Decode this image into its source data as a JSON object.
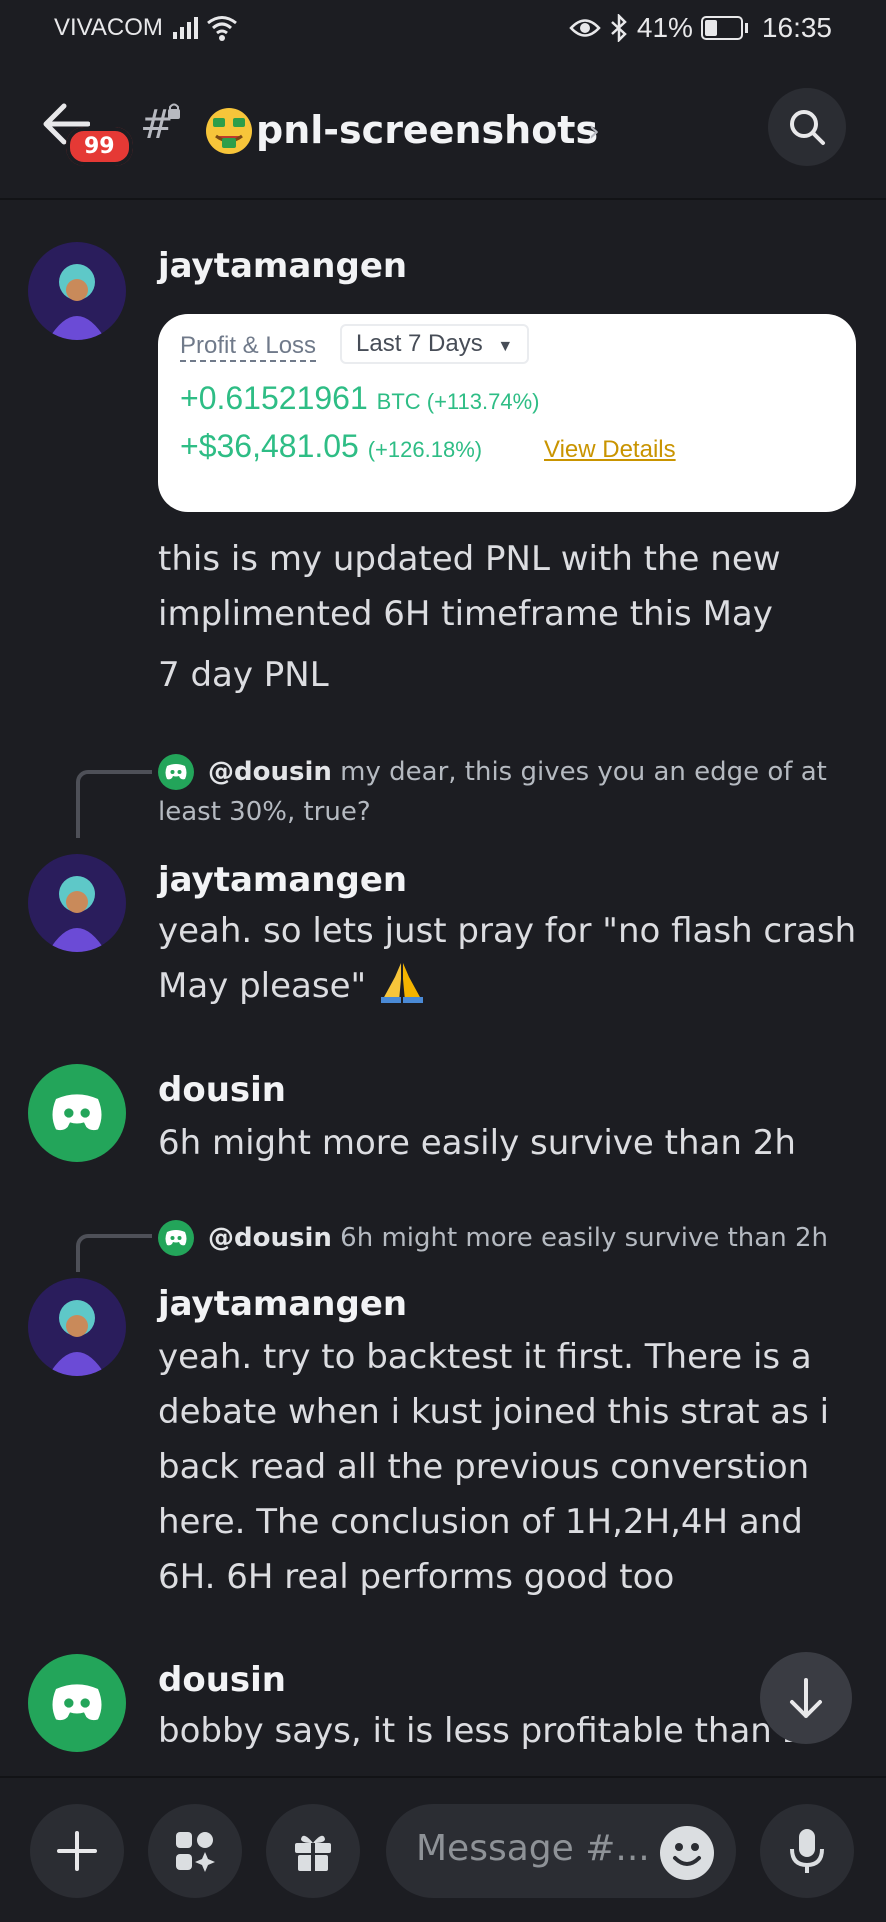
{
  "status_bar": {
    "carrier": "VIVACOM",
    "battery": "41%",
    "battery_level": 0.41,
    "time": "16:35"
  },
  "header": {
    "unread_count": "99",
    "channel_name": "pnl-screenshots",
    "channel_emoji": "money-mouth-face"
  },
  "messages": [
    {
      "username": "jaytamangen",
      "pnl_card": {
        "label": "Profit & Loss",
        "range": "Last 7 Days",
        "btc_value": "+0.61521961",
        "btc_unit": "BTC (+113.74%)",
        "usd_value": "+$36,481.05",
        "usd_pct": "(+126.18%)",
        "details_link": "View Details"
      },
      "lines": [
        "this is my updated PNL with the new",
        "implimented 6H timeframe this May",
        "7 day PNL"
      ]
    },
    {
      "reply_user": "@dousin",
      "reply_text_1": "my dear, this gives you an edge of at",
      "reply_text_2": "least 30%, true?",
      "username": "jaytamangen",
      "lines": [
        "yeah. so lets just pray for \"no flash crash",
        "May please\""
      ]
    },
    {
      "username": "dousin",
      "lines": [
        "6h might more easily survive than 2h"
      ]
    },
    {
      "reply_user": "@dousin",
      "reply_text": "6h might more easily survive than 2h",
      "username": "jaytamangen",
      "lines": [
        "yeah. try to backtest it first. There is a",
        "debate when i kust joined this strat as i",
        "back read all the previous converstion",
        "here. The conclusion of 1H,2H,4H and",
        "6H. 6H real performs good too"
      ]
    },
    {
      "username": "dousin",
      "lines": [
        "bobby says, it is less profitable than 2"
      ]
    }
  ],
  "composer": {
    "placeholder": "Message #..."
  },
  "colors": {
    "background": "#1c1d22",
    "discord_green": "#23a55a",
    "badge_red": "#e53935",
    "profit_green": "#2ebd85"
  }
}
